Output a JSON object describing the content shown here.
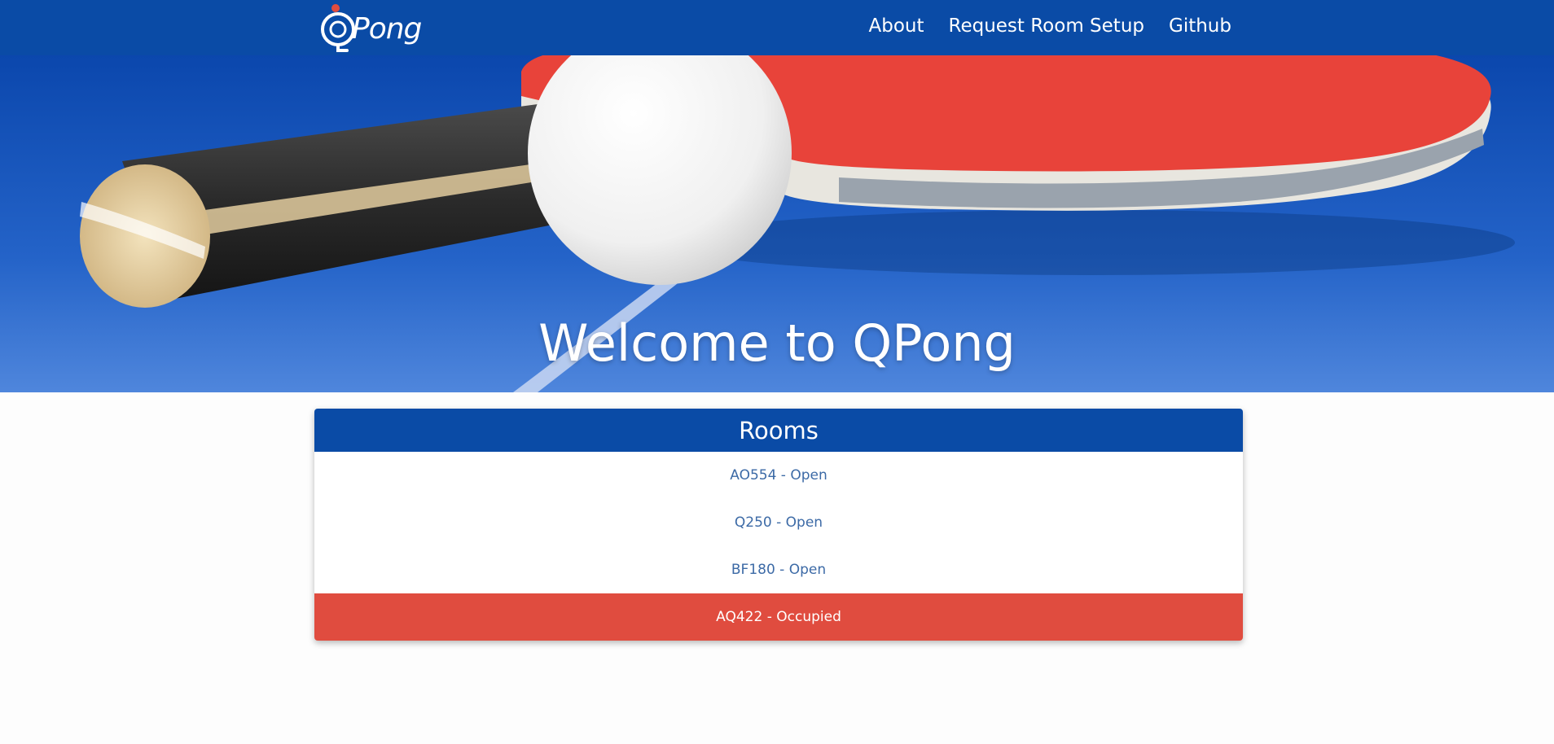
{
  "app": {
    "logo_text": "Pong",
    "brand_color": "#0a4ba6",
    "occupied_color": "#e04c3f"
  },
  "nav": {
    "items": [
      {
        "label": "About"
      },
      {
        "label": "Request Room Setup"
      },
      {
        "label": "Github"
      }
    ]
  },
  "hero": {
    "title": "Welcome to QPong"
  },
  "rooms": {
    "title": "Rooms",
    "items": [
      {
        "label": "AO554 - Open",
        "status": "open"
      },
      {
        "label": "Q250 - Open",
        "status": "open"
      },
      {
        "label": "BF180 - Open",
        "status": "open"
      },
      {
        "label": "AQ422 - Occupied",
        "status": "occupied"
      }
    ]
  }
}
